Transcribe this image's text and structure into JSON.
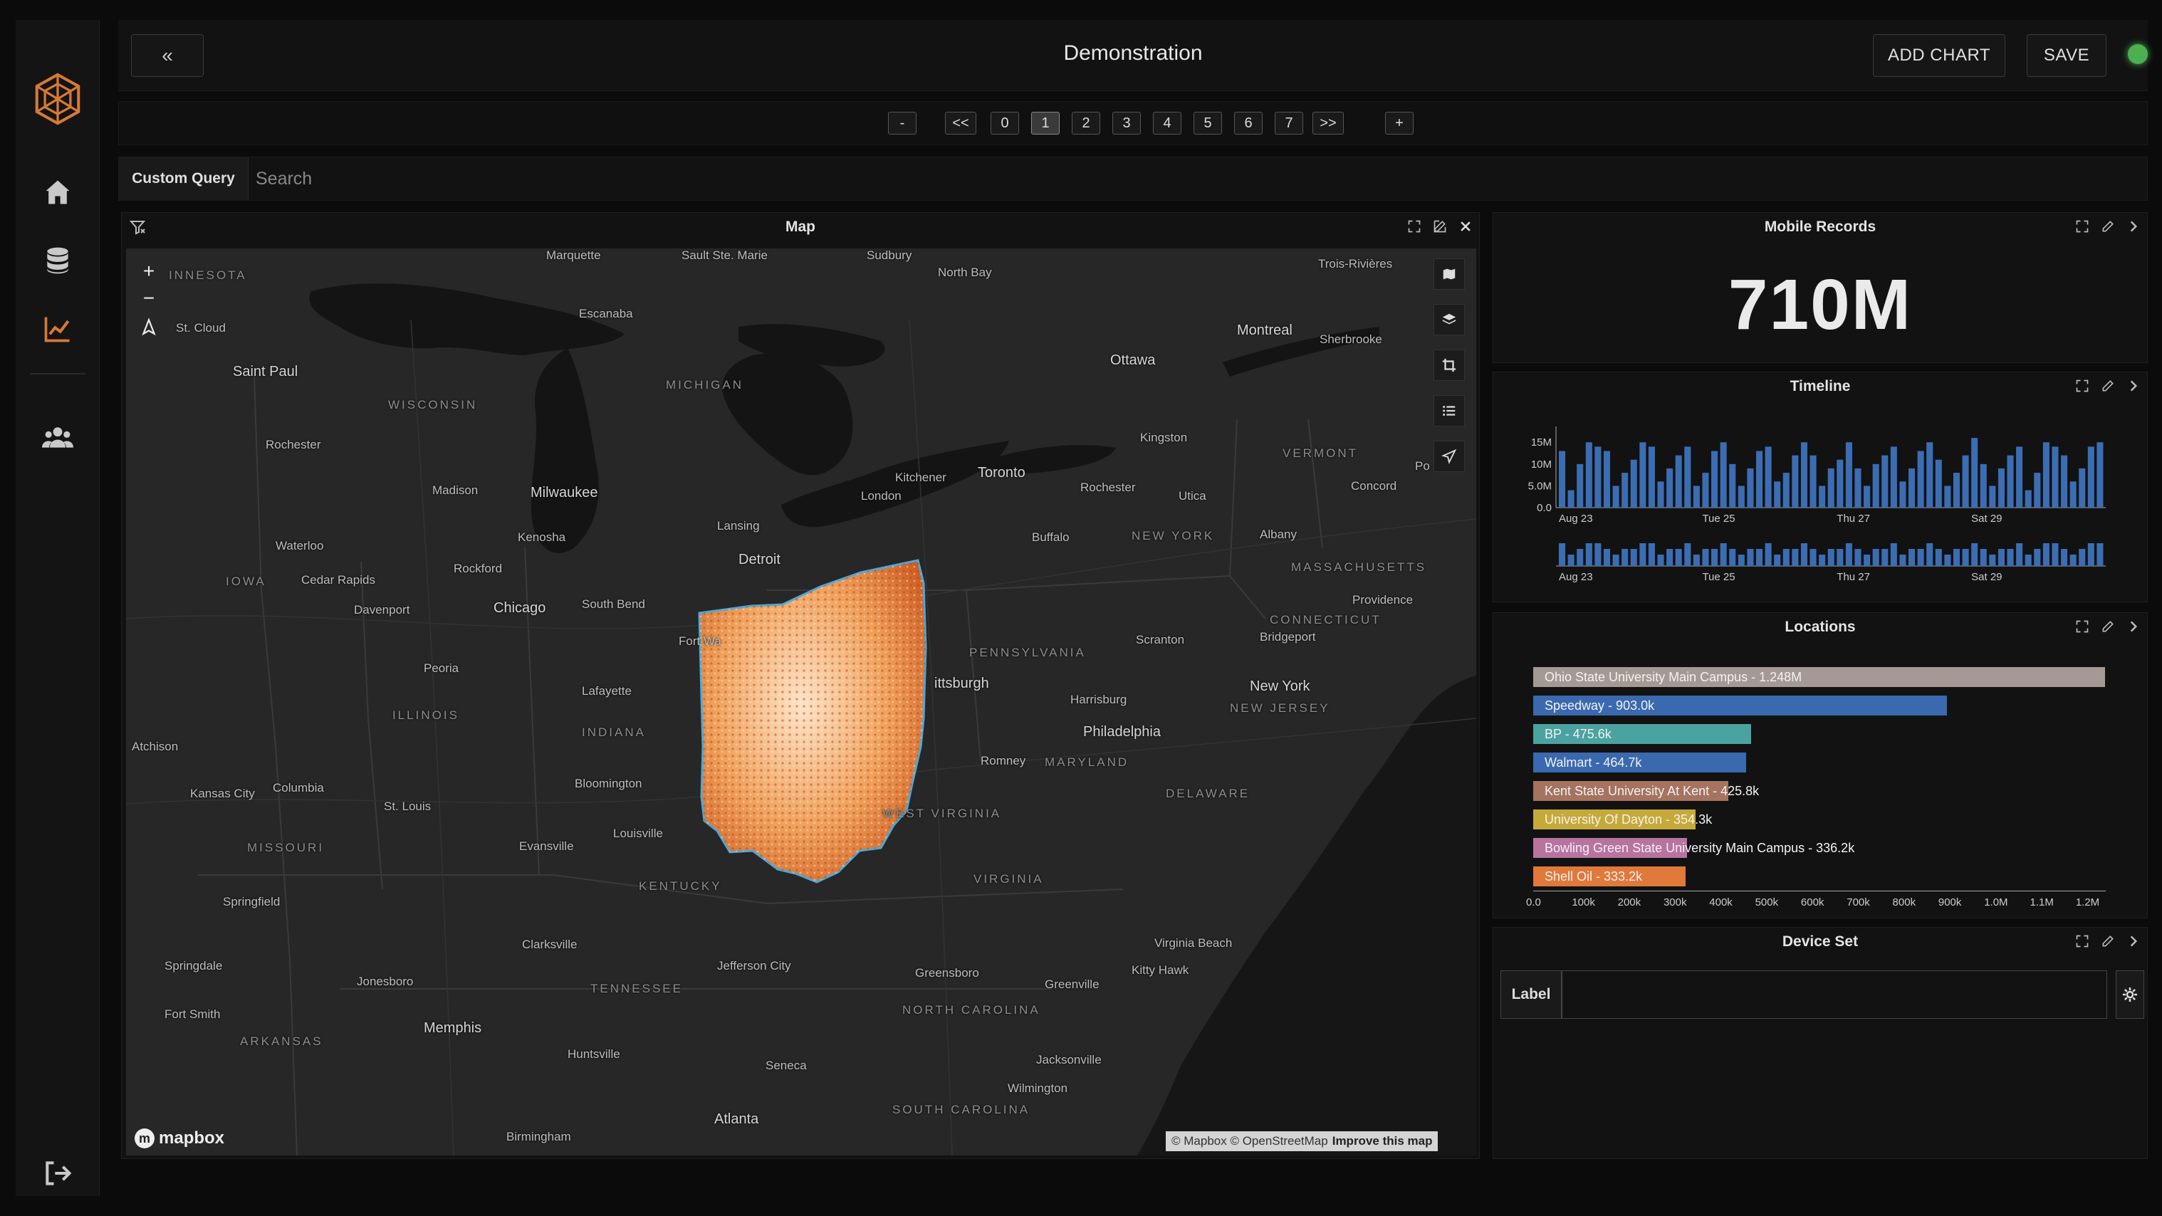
{
  "header": {
    "title": "Demonstration",
    "collapse_label": "«",
    "add_chart_label": "ADD CHART",
    "save_label": "SAVE"
  },
  "pagination": {
    "minus_label": "-",
    "first_label": "<<",
    "pages": [
      "0",
      "1",
      "2",
      "3",
      "4",
      "5",
      "6",
      "7"
    ],
    "active_page": "1",
    "last_label": ">>",
    "plus_label": "+"
  },
  "query": {
    "mode_label": "Custom Query",
    "placeholder": "Search"
  },
  "sidebar": {
    "items": [
      {
        "icon": "logo-icon"
      },
      {
        "icon": "home-icon"
      },
      {
        "icon": "database-icon"
      },
      {
        "icon": "chart-icon"
      },
      {
        "icon": "users-icon"
      },
      {
        "icon": "logout-icon"
      }
    ]
  },
  "map_panel": {
    "title": "Map",
    "zoom_in": "+",
    "zoom_out": "−",
    "logo_text": "mapbox",
    "attribution": "© Mapbox © OpenStreetMap",
    "attribution_link": "Improve this map",
    "highlight_color": "#e0783a",
    "labels": [
      {
        "text": "INNESOTA",
        "kind": "region"
      },
      {
        "text": "Marquette",
        "kind": "town"
      },
      {
        "text": "Sault Ste. Marie",
        "kind": "town"
      },
      {
        "text": "Sudbury",
        "kind": "town"
      },
      {
        "text": "North Bay",
        "kind": "town"
      },
      {
        "text": "Trois-Rivières",
        "kind": "town"
      },
      {
        "text": "St. Cloud",
        "kind": "town"
      },
      {
        "text": "Escanaba",
        "kind": "town"
      },
      {
        "text": "Montreal",
        "kind": "city"
      },
      {
        "text": "Sherbrooke",
        "kind": "town"
      },
      {
        "text": "Saint Paul",
        "kind": "city"
      },
      {
        "text": "WISCONSIN",
        "kind": "region"
      },
      {
        "text": "MICHIGAN",
        "kind": "region"
      },
      {
        "text": "Ottawa",
        "kind": "city"
      },
      {
        "text": "Rochester",
        "kind": "town"
      },
      {
        "text": "Kingston",
        "kind": "town"
      },
      {
        "text": "VERMONT",
        "kind": "region"
      },
      {
        "text": "Toronto",
        "kind": "city"
      },
      {
        "text": "Kitchener",
        "kind": "town"
      },
      {
        "text": "Madison",
        "kind": "town"
      },
      {
        "text": "Milwaukee",
        "kind": "city"
      },
      {
        "text": "Rochester",
        "kind": "town"
      },
      {
        "text": "Concord",
        "kind": "town"
      },
      {
        "text": "London",
        "kind": "town"
      },
      {
        "text": "Utica",
        "kind": "town"
      },
      {
        "text": "Kenosha",
        "kind": "town"
      },
      {
        "text": "Lansing",
        "kind": "town"
      },
      {
        "text": "Waterloo",
        "kind": "town"
      },
      {
        "text": "Buffalo",
        "kind": "town"
      },
      {
        "text": "Albany",
        "kind": "town"
      },
      {
        "text": "NEW YORK",
        "kind": "region"
      },
      {
        "text": "Rockford",
        "kind": "town"
      },
      {
        "text": "Detroit",
        "kind": "city"
      },
      {
        "text": "MASSACHUSETTS",
        "kind": "region"
      },
      {
        "text": "IOWA",
        "kind": "region"
      },
      {
        "text": "Cedar Rapids",
        "kind": "town"
      },
      {
        "text": "Providence",
        "kind": "town"
      },
      {
        "text": "Chicago",
        "kind": "city"
      },
      {
        "text": "South Bend",
        "kind": "town"
      },
      {
        "text": "Davenport",
        "kind": "town"
      },
      {
        "text": "CONNECTICUT",
        "kind": "region"
      },
      {
        "text": "Scranton",
        "kind": "town"
      },
      {
        "text": "Bridgeport",
        "kind": "town"
      },
      {
        "text": "Fort Wa",
        "kind": "town"
      },
      {
        "text": "PENNSYLVANIA",
        "kind": "region"
      },
      {
        "text": "Peoria",
        "kind": "town"
      },
      {
        "text": "Lafayette",
        "kind": "town"
      },
      {
        "text": "ittsburgh",
        "kind": "city"
      },
      {
        "text": "New York",
        "kind": "city"
      },
      {
        "text": "Harrisburg",
        "kind": "town"
      },
      {
        "text": "ILLINOIS",
        "kind": "region"
      },
      {
        "text": "INDIANA",
        "kind": "region"
      },
      {
        "text": "NEW JERSEY",
        "kind": "region"
      },
      {
        "text": "Philadelphia",
        "kind": "city"
      },
      {
        "text": "Atchison",
        "kind": "town"
      },
      {
        "text": "Romney",
        "kind": "town"
      },
      {
        "text": "MARYLAND",
        "kind": "region"
      },
      {
        "text": "Bloomington",
        "kind": "town"
      },
      {
        "text": "Kansas City",
        "kind": "town"
      },
      {
        "text": "Columbia",
        "kind": "town"
      },
      {
        "text": "DELAWARE",
        "kind": "region"
      },
      {
        "text": "St. Louis",
        "kind": "town"
      },
      {
        "text": "WEST VIRGINIA",
        "kind": "region"
      },
      {
        "text": "Louisville",
        "kind": "town"
      },
      {
        "text": "MISSOURI",
        "kind": "region"
      },
      {
        "text": "Evansville",
        "kind": "town"
      },
      {
        "text": "VIRGINIA",
        "kind": "region"
      },
      {
        "text": "KENTUCKY",
        "kind": "region"
      },
      {
        "text": "Springfield",
        "kind": "town"
      },
      {
        "text": "Clarksville",
        "kind": "town"
      },
      {
        "text": "Virginia Beach",
        "kind": "town"
      },
      {
        "text": "Springdale",
        "kind": "town"
      },
      {
        "text": "Jefferson City",
        "kind": "town"
      },
      {
        "text": "Greensboro",
        "kind": "town"
      },
      {
        "text": "Kitty Hawk",
        "kind": "town"
      },
      {
        "text": "Jonesboro",
        "kind": "town"
      },
      {
        "text": "TENNESSEE",
        "kind": "region"
      },
      {
        "text": "Greenville",
        "kind": "town"
      },
      {
        "text": "NORTH CAROLINA",
        "kind": "region"
      },
      {
        "text": "Fort Smith",
        "kind": "town"
      },
      {
        "text": "Memphis",
        "kind": "city"
      },
      {
        "text": "ARKANSAS",
        "kind": "region"
      },
      {
        "text": "Huntsville",
        "kind": "town"
      },
      {
        "text": "Seneca",
        "kind": "town"
      },
      {
        "text": "Jacksonville",
        "kind": "town"
      },
      {
        "text": "Wilmington",
        "kind": "town"
      },
      {
        "text": "SOUTH CAROLINA",
        "kind": "region"
      },
      {
        "text": "Atlanta",
        "kind": "city"
      },
      {
        "text": "Birmingham",
        "kind": "town"
      },
      {
        "text": "Po",
        "kind": "town"
      }
    ]
  },
  "records_panel": {
    "title": "Mobile Records",
    "value": "710M"
  },
  "timeline_panel": {
    "title": "Timeline",
    "y_ticks": [
      "15M",
      "10M",
      "5.0M",
      "0.0"
    ],
    "x_ticks": [
      "Aug 23",
      "Tue 25",
      "Thu 27",
      "Sat 29"
    ],
    "bar_color": "#3b6db3"
  },
  "locations_panel": {
    "title": "Locations",
    "x_ticks": [
      "0.0",
      "100k",
      "200k",
      "300k",
      "400k",
      "500k",
      "600k",
      "700k",
      "800k",
      "900k",
      "1.0M",
      "1.1M",
      "1.2M"
    ]
  },
  "device_panel": {
    "title": "Device Set",
    "label": "Label"
  },
  "chart_data": [
    {
      "type": "bar",
      "title": "Timeline",
      "x_ticks": [
        "Aug 23",
        "Tue 25",
        "Thu 27",
        "Sat 29"
      ],
      "y_ticks": [
        "15M",
        "10M",
        "5.0M",
        "0.0"
      ],
      "ylim": [
        0,
        17000000
      ],
      "values": [
        13,
        4,
        10,
        15,
        14,
        13,
        5,
        8,
        11,
        15,
        14,
        6,
        9,
        12,
        14,
        5,
        8,
        13,
        15,
        10,
        5,
        9,
        13,
        14,
        6,
        8,
        12,
        15,
        12,
        5,
        9,
        11,
        15,
        9,
        5,
        10,
        12,
        14,
        6,
        9,
        13,
        15,
        11,
        5,
        8,
        12,
        16,
        10,
        5,
        9,
        12,
        14,
        4,
        8,
        15,
        14,
        12,
        6,
        9,
        14,
        15
      ],
      "unit_note": "values in millions",
      "brush_values": [
        4,
        2,
        3,
        4,
        4,
        3,
        2,
        3,
        3,
        4,
        4,
        2,
        3,
        3,
        4,
        2,
        3,
        3,
        4,
        3,
        2,
        3,
        3,
        4,
        2,
        3,
        3,
        4,
        3,
        2,
        3,
        3,
        4,
        3,
        2,
        3,
        3,
        4,
        2,
        3,
        3,
        4,
        3,
        2,
        3,
        3,
        4,
        3,
        2,
        3,
        3,
        4,
        2,
        3,
        4,
        4,
        3,
        2,
        3,
        4,
        4
      ]
    },
    {
      "type": "bar",
      "title": "Locations",
      "orientation": "horizontal",
      "xlim": [
        0,
        1250000
      ],
      "categories": [
        "Ohio State University Main Campus - 1.248M",
        "Speedway - 903.0k",
        "BP - 475.6k",
        "Walmart - 464.7k",
        "Kent State University At Kent - 425.8k",
        "University Of Dayton - 354.3k",
        "Bowling Green State University Main Campus - 336.2k",
        "Shell Oil - 333.2k"
      ],
      "values": [
        1248000,
        903000,
        475600,
        464700,
        425800,
        354300,
        336200,
        333200
      ],
      "colors": [
        "#a59a93",
        "#3a69b0",
        "#4aa3a0",
        "#3a69b0",
        "#a5735f",
        "#c7a93a",
        "#b873a0",
        "#e0793a"
      ]
    }
  ]
}
